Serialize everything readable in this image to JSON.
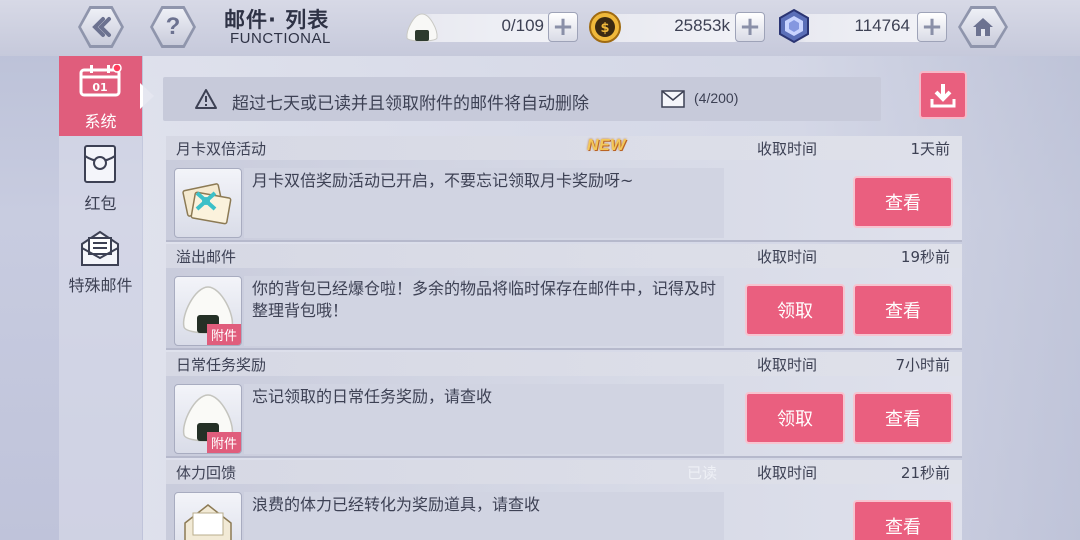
{
  "header": {
    "title": "邮件· 列表",
    "subtitle": "FUNCTIONAL",
    "back_icon": "chevron-left-icon",
    "help_icon": "question-icon",
    "home_icon": "home-icon"
  },
  "resources": [
    {
      "icon": "rice-ball-icon",
      "value": "0/109"
    },
    {
      "icon": "gold-coin-icon",
      "value": "25853k"
    },
    {
      "icon": "crystal-icon",
      "value": "114764"
    }
  ],
  "sidebar": {
    "items": [
      {
        "label": "系统",
        "icon": "calendar-mail-icon",
        "active": true
      },
      {
        "label": "红包",
        "icon": "red-envelope-icon",
        "active": false
      },
      {
        "label": "特殊邮件",
        "icon": "special-mail-icon",
        "active": false
      }
    ]
  },
  "notice": {
    "icon": "warning-icon",
    "text": "超过七天或已读并且领取附件的邮件将自动删除",
    "mail_icon": "envelope-icon",
    "count": "(4/200)"
  },
  "download_icon": "download-icon",
  "mails": [
    {
      "category": "月卡双倍活动",
      "badge": "NEW",
      "time_label": "收取时间",
      "time": "1天前",
      "text": "月卡双倍奖励活动已开启，不要忘记领取月卡奖励呀~",
      "icon": "gift-card-icon",
      "attachment_tag": "",
      "claim_label": "",
      "view_label": "查看"
    },
    {
      "category": "溢出邮件",
      "badge": "",
      "time_label": "收取时间",
      "time": "19秒前",
      "text": "你的背包已经爆仓啦！多余的物品将临时保存在邮件中，记得及时整理背包哦！",
      "icon": "rice-ball-icon",
      "attachment_tag": "附件",
      "claim_label": "领取",
      "view_label": "查看"
    },
    {
      "category": "日常任务奖励",
      "badge": "",
      "time_label": "收取时间",
      "time": "7小时前",
      "text": "忘记领取的日常任务奖励，请查收",
      "icon": "rice-ball-icon",
      "attachment_tag": "附件",
      "claim_label": "领取",
      "view_label": "查看"
    },
    {
      "category": "体力回馈",
      "badge": "",
      "read_label": "已读",
      "time_label": "收取时间",
      "time": "21秒前",
      "text": "浪费的体力已经转化为奖励道具，请查收",
      "icon": "open-envelope-icon",
      "attachment_tag": "",
      "claim_label": "",
      "view_label": "查看"
    }
  ],
  "colors": {
    "accent": "#ea5f7f",
    "panel": "#d6d9e6",
    "text": "#3d4154"
  }
}
